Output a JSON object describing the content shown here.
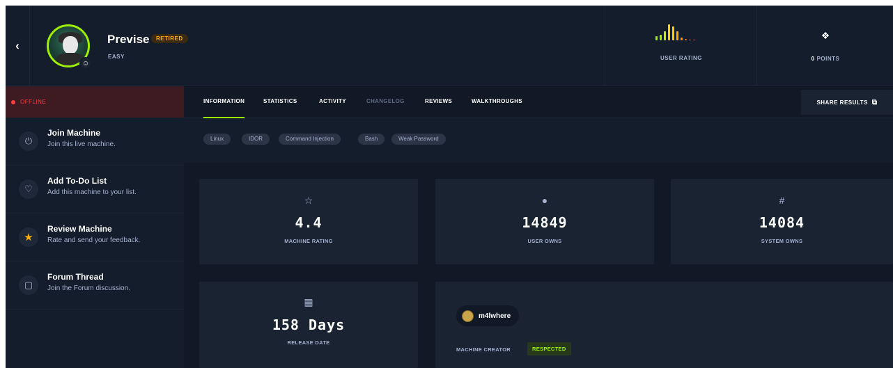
{
  "header": {
    "machine_name": "Previse",
    "status_badge": "RETIRED",
    "difficulty": "EASY",
    "user_rating_label": "USER RATING",
    "points_value": "0",
    "points_label": "POINTS"
  },
  "rating_bars": {
    "colors": [
      "#9fef00",
      "#9fef00",
      "#c6e900",
      "#ffcc00",
      "#ffcc00",
      "#ffaf00",
      "#ff8f00",
      "#ff6a00",
      "#ff3e3e",
      "#ff3e3e"
    ],
    "levels": [
      0.25,
      0.35,
      0.55,
      0.95,
      0.85,
      0.55,
      0.15,
      0.08,
      0.05,
      0.04
    ]
  },
  "sidebar": {
    "status": "OFFLINE",
    "items": [
      {
        "title": "Join Machine",
        "desc": "Join this live machine.",
        "icon": "power-icon"
      },
      {
        "title": "Add To-Do List",
        "desc": "Add this machine to your list.",
        "icon": "heart-icon"
      },
      {
        "title": "Review Machine",
        "desc": "Rate and send your feedback.",
        "icon": "star-icon"
      },
      {
        "title": "Forum Thread",
        "desc": "Join the Forum discussion.",
        "icon": "note-icon"
      }
    ]
  },
  "tabs": [
    "INFORMATION",
    "STATISTICS",
    "ACTIVITY",
    "CHANGELOG",
    "REVIEWS",
    "WALKTHROUGHS"
  ],
  "share_label": "SHARE RESULTS",
  "tags": [
    "Linux",
    "IDOR",
    "Command Injection",
    "Bash",
    "Weak Password"
  ],
  "stats": {
    "rating": {
      "value": "4.4",
      "label": "MACHINE RATING"
    },
    "user_owns": {
      "value": "14849",
      "label": "USER OWNS"
    },
    "system_owns": {
      "value": "14084",
      "label": "SYSTEM OWNS"
    },
    "release": {
      "value": "158 Days",
      "label": "RELEASE DATE"
    }
  },
  "creator": {
    "name": "m4lwhere",
    "label": "MACHINE CREATOR",
    "badge": "RESPECTED"
  },
  "colors": {
    "background": "#111927",
    "panel": "#1a2332",
    "accent_green": "#9fef00",
    "retired_orange": "#ffaf00",
    "offline_red": "#ff3e3e"
  }
}
